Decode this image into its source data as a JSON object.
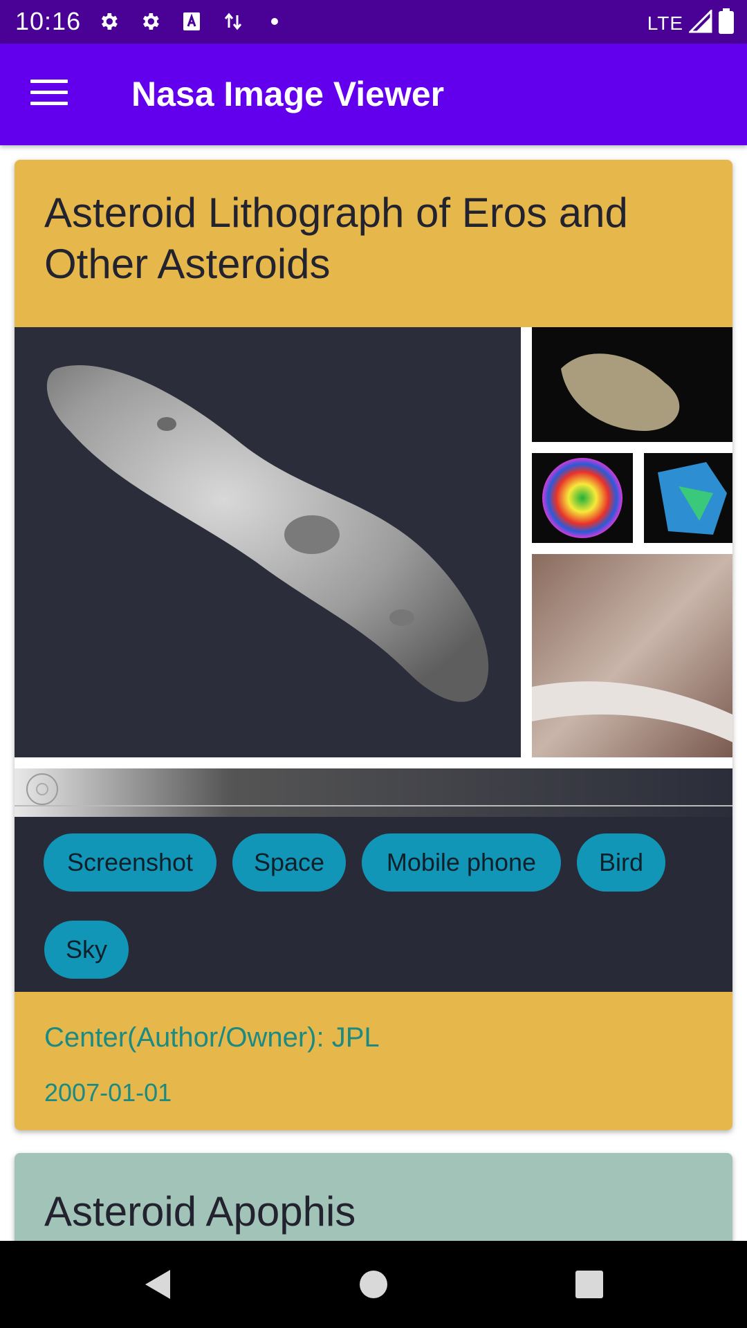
{
  "status_bar": {
    "time": "10:16",
    "network": "LTE",
    "icons": [
      "gear-icon",
      "gear-icon",
      "text-a-icon",
      "data-transfer-icon",
      "dot-icon",
      "signal-icon",
      "battery-icon"
    ]
  },
  "app_bar": {
    "title": "Nasa Image Viewer",
    "menu_icon": "hamburger-menu-icon"
  },
  "cards": [
    {
      "title": "Asteroid Lithograph of Eros and Other Asteroids",
      "background_color": "#e6b74b",
      "tags": [
        "Screenshot",
        "Space",
        "Mobile phone",
        "Bird",
        "Sky"
      ],
      "owner_label": "Center(Author/Owner): JPL",
      "date": "2007-01-01"
    },
    {
      "title": "Asteroid Apophis",
      "background_color": "#a1c3b8"
    }
  ],
  "nav_bar": {
    "buttons": [
      "back-icon",
      "home-icon",
      "recents-icon"
    ]
  },
  "colors": {
    "status_bar": "#4a0296",
    "app_bar": "#6200ee",
    "chip": "#1296b8",
    "meta_text": "#1a8a82"
  }
}
